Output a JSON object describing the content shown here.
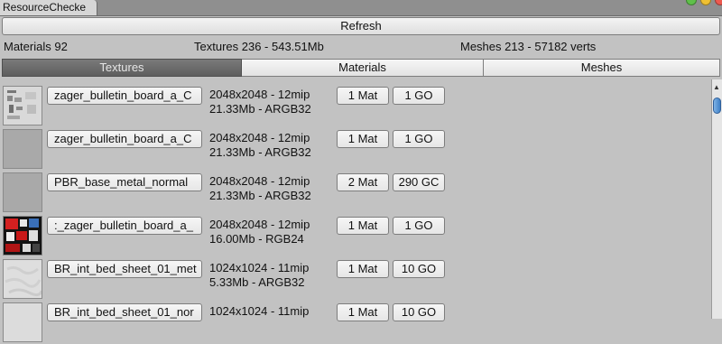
{
  "window": {
    "tab_title": "ResourceChecke"
  },
  "toolbar": {
    "refresh_label": "Refresh"
  },
  "stats": {
    "materials": "Materials 92",
    "textures": "Textures 236 - 543.51Mb",
    "meshes": "Meshes 213 - 57182 verts"
  },
  "tabs": [
    {
      "label": "Textures",
      "active": true
    },
    {
      "label": "Materials",
      "active": false
    },
    {
      "label": "Meshes",
      "active": false
    }
  ],
  "rows": [
    {
      "name": "zager_bulletin_board_a_C",
      "line1": "2048x2048 - 12mip",
      "line2": "21.33Mb - ARGB32",
      "mat": "1 Mat",
      "go": "1 GO",
      "thumb": "doc"
    },
    {
      "name": "zager_bulletin_board_a_C",
      "line1": "2048x2048 - 12mip",
      "line2": "21.33Mb - ARGB32",
      "mat": "1 Mat",
      "go": "1 GO",
      "thumb": "gray"
    },
    {
      "name": "PBR_base_metal_normal",
      "line1": "2048x2048 - 12mip",
      "line2": "21.33Mb - ARGB32",
      "mat": "2 Mat",
      "go": "290 GC",
      "thumb": "gray"
    },
    {
      "name": ":_zager_bulletin_board_a_",
      "line1": "2048x2048 - 12mip",
      "line2": "16.00Mb - RGB24",
      "mat": "1 Mat",
      "go": "1 GO",
      "thumb": "red"
    },
    {
      "name": "BR_int_bed_sheet_01_met",
      "line1": "1024x1024 - 11mip",
      "line2": "5.33Mb - ARGB32",
      "mat": "1 Mat",
      "go": "10 GO",
      "thumb": "sheet"
    },
    {
      "name": "BR_int_bed_sheet_01_nor",
      "line1": "1024x1024 - 11mip",
      "line2": "",
      "mat": "1 Mat",
      "go": "10 GO",
      "thumb": "sheet"
    }
  ]
}
